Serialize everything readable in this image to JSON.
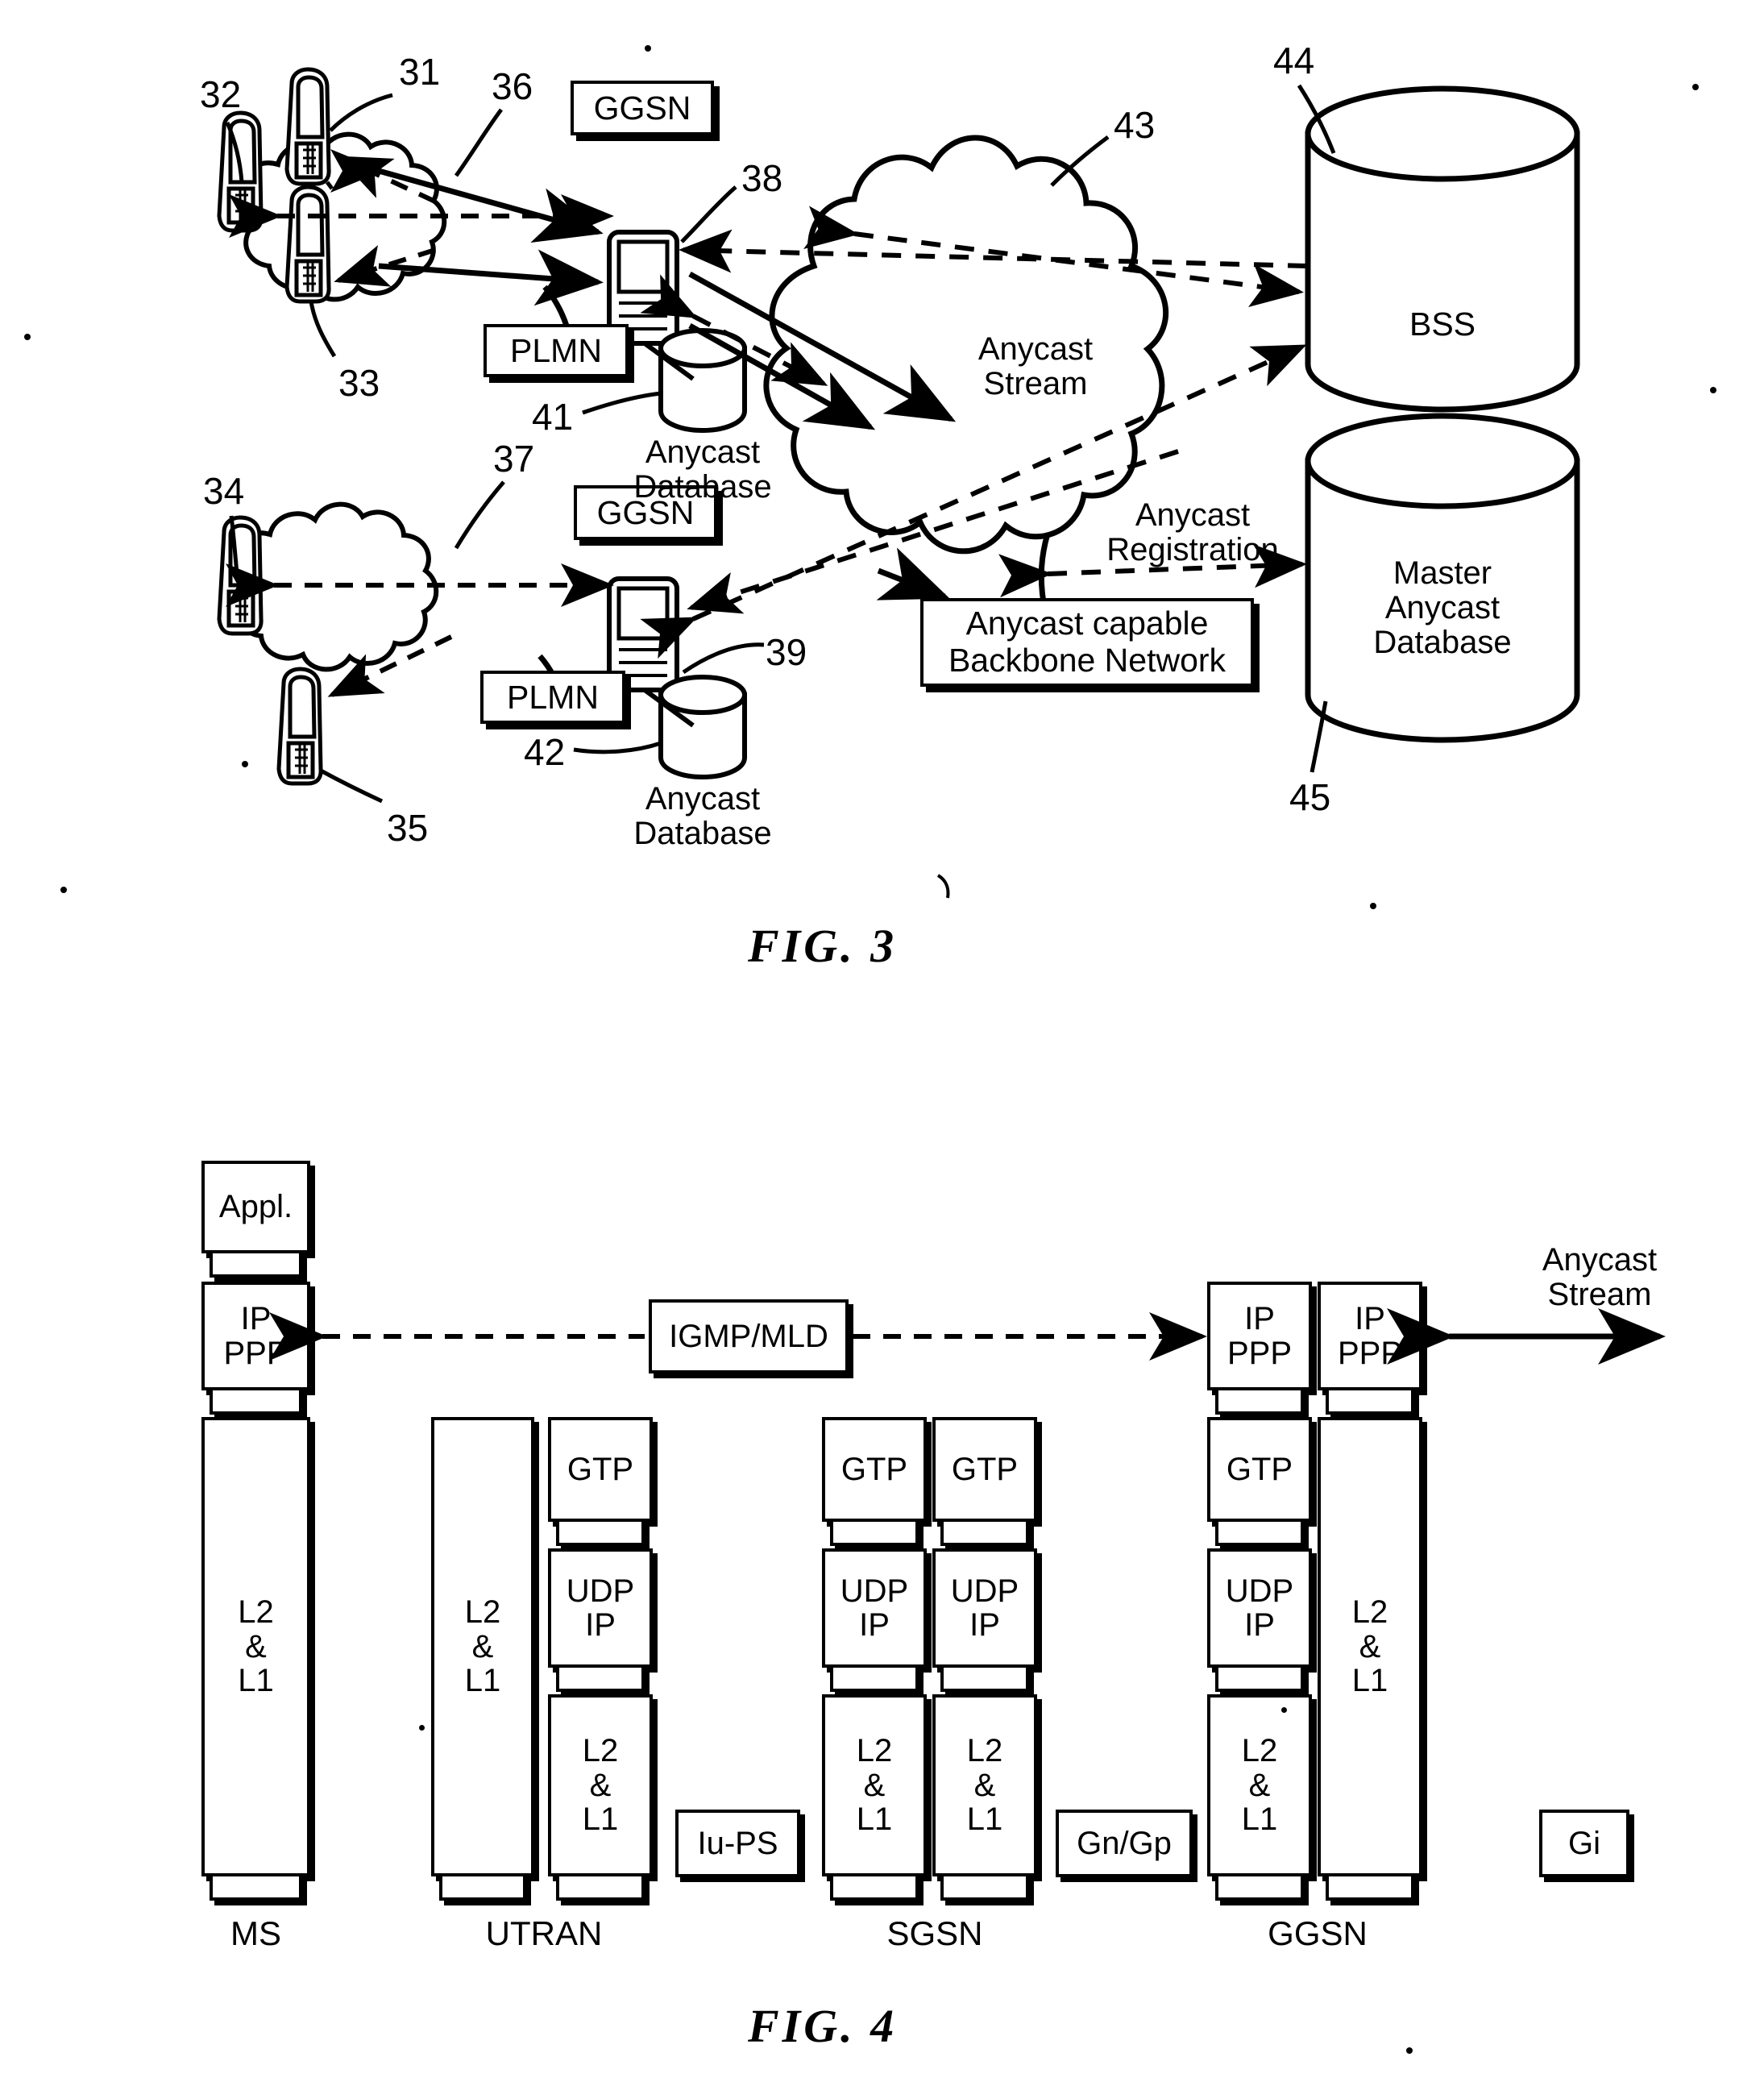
{
  "figures": [
    {
      "id": "fig3",
      "caption": "FIG.  3",
      "reference_numbers": [
        "31",
        "32",
        "33",
        "34",
        "35",
        "36",
        "37",
        "38",
        "39",
        "41",
        "42",
        "43",
        "44",
        "45"
      ],
      "nodes": {
        "ggsn_label_top": "GGSN",
        "ggsn_label_bottom": "GGSN",
        "plmn_label_top": "PLMN",
        "plmn_label_bottom": "PLMN",
        "anycast_db_top_line1": "Anycast",
        "anycast_db_top_line2": "Database",
        "anycast_db_bottom_line1": "Anycast",
        "anycast_db_bottom_line2": "Database",
        "anycast_stream_line1": "Anycast",
        "anycast_stream_line2": "Stream",
        "anycast_registration_line1": "Anycast",
        "anycast_registration_line2": "Registration",
        "backbone_line1": "Anycast capable",
        "backbone_line2": "Backbone Network",
        "bss": "BSS",
        "master_db_line1": "Master",
        "master_db_line2": "Anycast",
        "master_db_line3": "Database"
      }
    },
    {
      "id": "fig4",
      "caption": "FIG.  4",
      "columns": [
        {
          "name": "MS",
          "label": "MS",
          "stacks": [
            {
              "blocks": [
                "Appl.",
                "IP\nPPP",
                "L2\n&\nL1"
              ]
            }
          ]
        },
        {
          "name": "UTRAN",
          "label": "UTRAN",
          "stacks": [
            {
              "blocks": [
                "L2\n&\nL1"
              ]
            },
            {
              "blocks": [
                "GTP",
                "UDP\nIP",
                "L2\n&\nL1"
              ]
            }
          ]
        },
        {
          "name": "SGSN",
          "label": "SGSN",
          "stacks": [
            {
              "blocks": [
                "GTP",
                "UDP\nIP",
                "L2\n&\nL1"
              ]
            },
            {
              "blocks": [
                "GTP",
                "UDP\nIP",
                "L2\n&\nL1"
              ]
            }
          ]
        },
        {
          "name": "GGSN",
          "label": "GGSN",
          "stacks": [
            {
              "blocks": [
                "IP\nPPP",
                "GTP",
                "UDP\nIP",
                "L2\n&\nL1"
              ]
            },
            {
              "blocks": [
                "IP\nPPP",
                "L2\n&\nL1"
              ]
            }
          ]
        }
      ],
      "interfaces": [
        "Iu-PS",
        "Gn/Gp",
        "Gi"
      ],
      "signalling_box": "IGMP/MLD",
      "anycast_stream_line1": "Anycast",
      "anycast_stream_line2": "Stream"
    }
  ]
}
